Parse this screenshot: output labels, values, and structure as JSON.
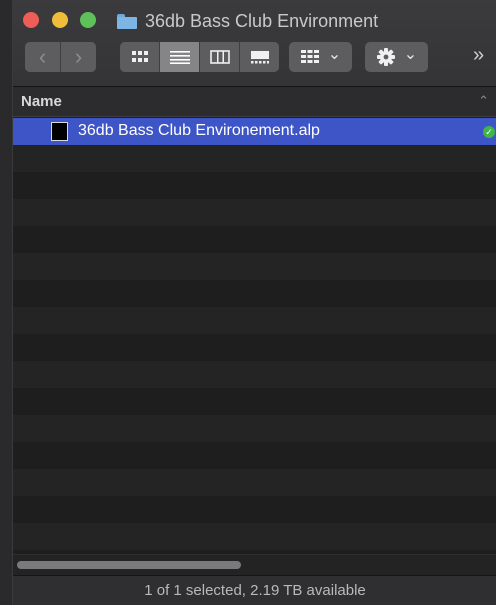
{
  "window": {
    "title": "36db Bass Club Environment",
    "title_icon": "folder-icon"
  },
  "toolbar": {
    "back_glyph": "‹",
    "forward_glyph": "›",
    "view_modes": [
      "icon-view",
      "list-view",
      "column-view",
      "gallery-view"
    ],
    "active_view": "list-view",
    "arrange_glyph": "⌄",
    "action_glyph": "⌄",
    "overflow_glyph": "»"
  },
  "list": {
    "column_header": "Name",
    "sort_glyph": "⌃",
    "files": [
      {
        "name": "36db Bass Club Environement.alp",
        "selected": true,
        "status": "synced"
      }
    ]
  },
  "status": {
    "text": "1 of 1 selected, 2.19 TB available"
  },
  "colors": {
    "selection": "#3d55c6",
    "close": "#ee5e57",
    "minimize": "#f0bd3b",
    "maximize": "#5ec15a",
    "status_ok": "#3fb54a"
  }
}
